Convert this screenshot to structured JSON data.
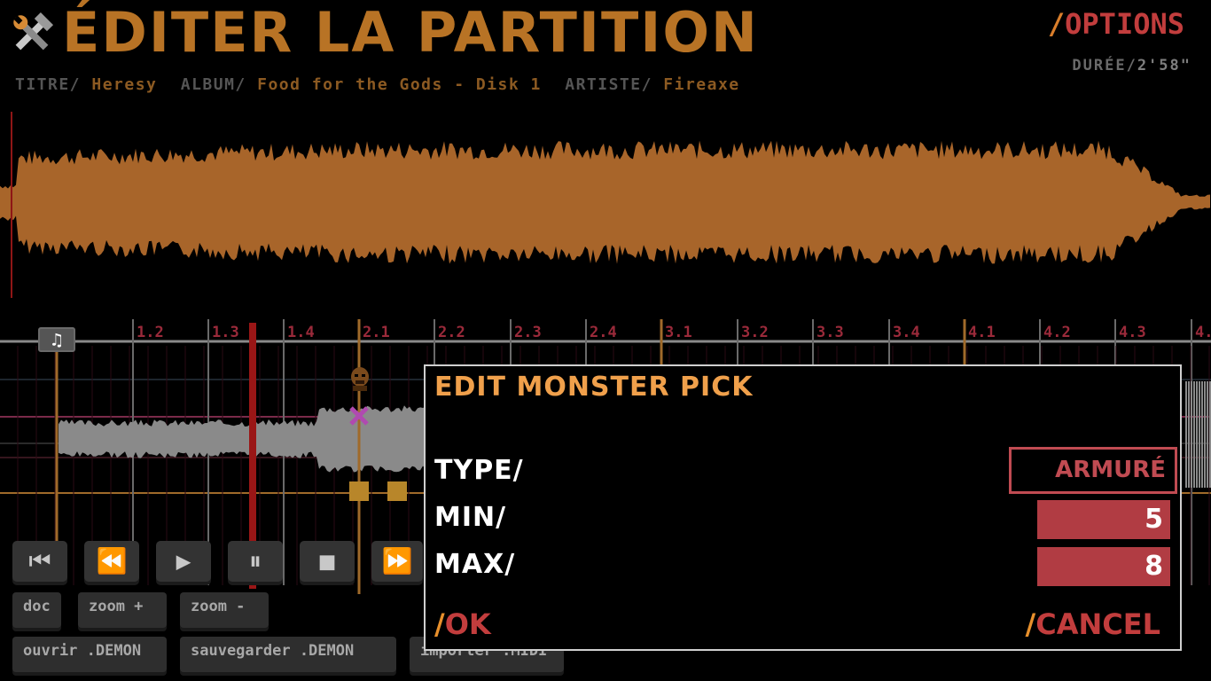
{
  "header": {
    "title": "ÉDITER LA PARTITION",
    "options_slash": "/",
    "options_label": "OPTIONS",
    "duration_label": "DURÉE/",
    "duration_value": "2'58\""
  },
  "meta": {
    "title_label": "TITRE/",
    "title_value": "Heresy",
    "album_label": "ALBUM/",
    "album_value": "Food for the Gods - Disk 1",
    "artist_label": "ARTISTE/",
    "artist_value": "Fireaxe"
  },
  "timeline": {
    "measures": [
      "1.2",
      "1.3",
      "1.4",
      "2.1",
      "2.2",
      "2.3",
      "2.4",
      "3.1",
      "3.2",
      "3.3",
      "3.4",
      "4.1",
      "4.2",
      "4.3",
      "4."
    ],
    "note_icon": "♫"
  },
  "transport": {
    "buttons": [
      {
        "name": "skip-to-start",
        "icon": "⏮"
      },
      {
        "name": "rewind",
        "icon": "⏪"
      },
      {
        "name": "play",
        "icon": "▶"
      },
      {
        "name": "pause",
        "icon": "⏸"
      },
      {
        "name": "stop",
        "icon": "■"
      },
      {
        "name": "fast-forward",
        "icon": "⏩"
      }
    ]
  },
  "toolbar": {
    "doc": "doc",
    "zoom_in": "zoom +",
    "zoom_out": "zoom -",
    "open": "ouvrir .DEMON",
    "save": "sauvegarder .DEMON",
    "import": "importer .MIDI"
  },
  "dialog": {
    "title": "EDIT MONSTER PICK",
    "type_label": "TYPE/",
    "type_value": "ARMURÉ",
    "min_label": "MIN/",
    "min_value": "5",
    "max_label": "MAX/",
    "max_value": "8",
    "ok_slash": "/",
    "ok_label": "OK",
    "cancel_slash": "/",
    "cancel_label": "CANCEL"
  },
  "colors": {
    "accent_orange": "#b87325",
    "accent_red": "#c23d3d",
    "field_red": "#b13c43"
  }
}
